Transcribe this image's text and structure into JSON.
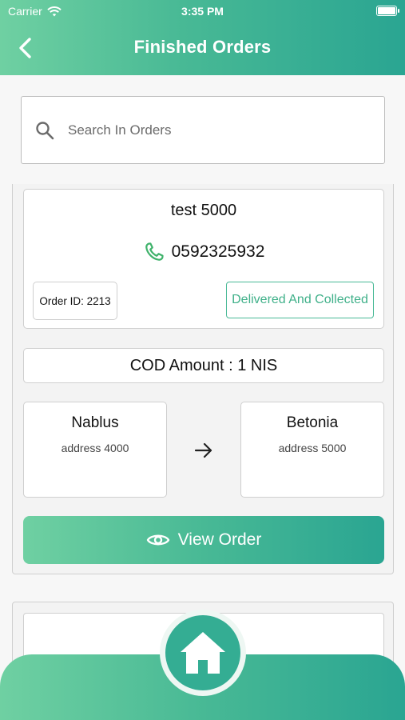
{
  "status_bar": {
    "carrier": "Carrier",
    "time": "3:35 PM"
  },
  "header": {
    "title": "Finished Orders"
  },
  "search": {
    "placeholder": "Search In Orders"
  },
  "orders": [
    {
      "customer_name": "test 5000",
      "phone": "0592325932",
      "order_id_label": "Order ID: 2213",
      "status": "Delivered And Collected",
      "cod_label": "COD Amount : 1 NIS",
      "from": {
        "city": "Nablus",
        "address": "address 4000"
      },
      "to": {
        "city": "Betonia",
        "address": "address 5000"
      },
      "view_button": "View Order"
    }
  ],
  "colors": {
    "accent_start": "#6fd0a2",
    "accent_end": "#2aa592",
    "status_green": "#3fb089"
  },
  "icons": [
    "back-arrow-icon",
    "search-icon",
    "phone-icon",
    "arrow-right-icon",
    "eye-icon",
    "home-icon",
    "wifi-icon",
    "battery-icon"
  ]
}
